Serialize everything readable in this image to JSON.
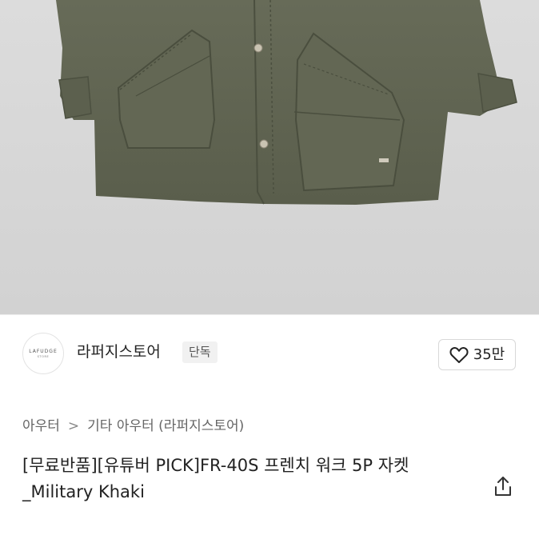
{
  "store": {
    "logo_text": "LAFUDGE",
    "logo_subtext": "STORE",
    "name": "라퍼지스토어",
    "badge": "단독",
    "like_count": "35만"
  },
  "breadcrumb": {
    "category": "아우터",
    "separator": ">",
    "subcategory": "기타 아우터 (라퍼지스토어)"
  },
  "product": {
    "title": "[무료반품][유튜버 PICK]FR-40S 프렌치 워크 5P 자켓_Military Khaki"
  },
  "icons": {
    "heart": "heart-outline-icon",
    "share": "share-icon"
  },
  "colors": {
    "jacket": "#5f6351",
    "background": "#d6d6d6"
  }
}
